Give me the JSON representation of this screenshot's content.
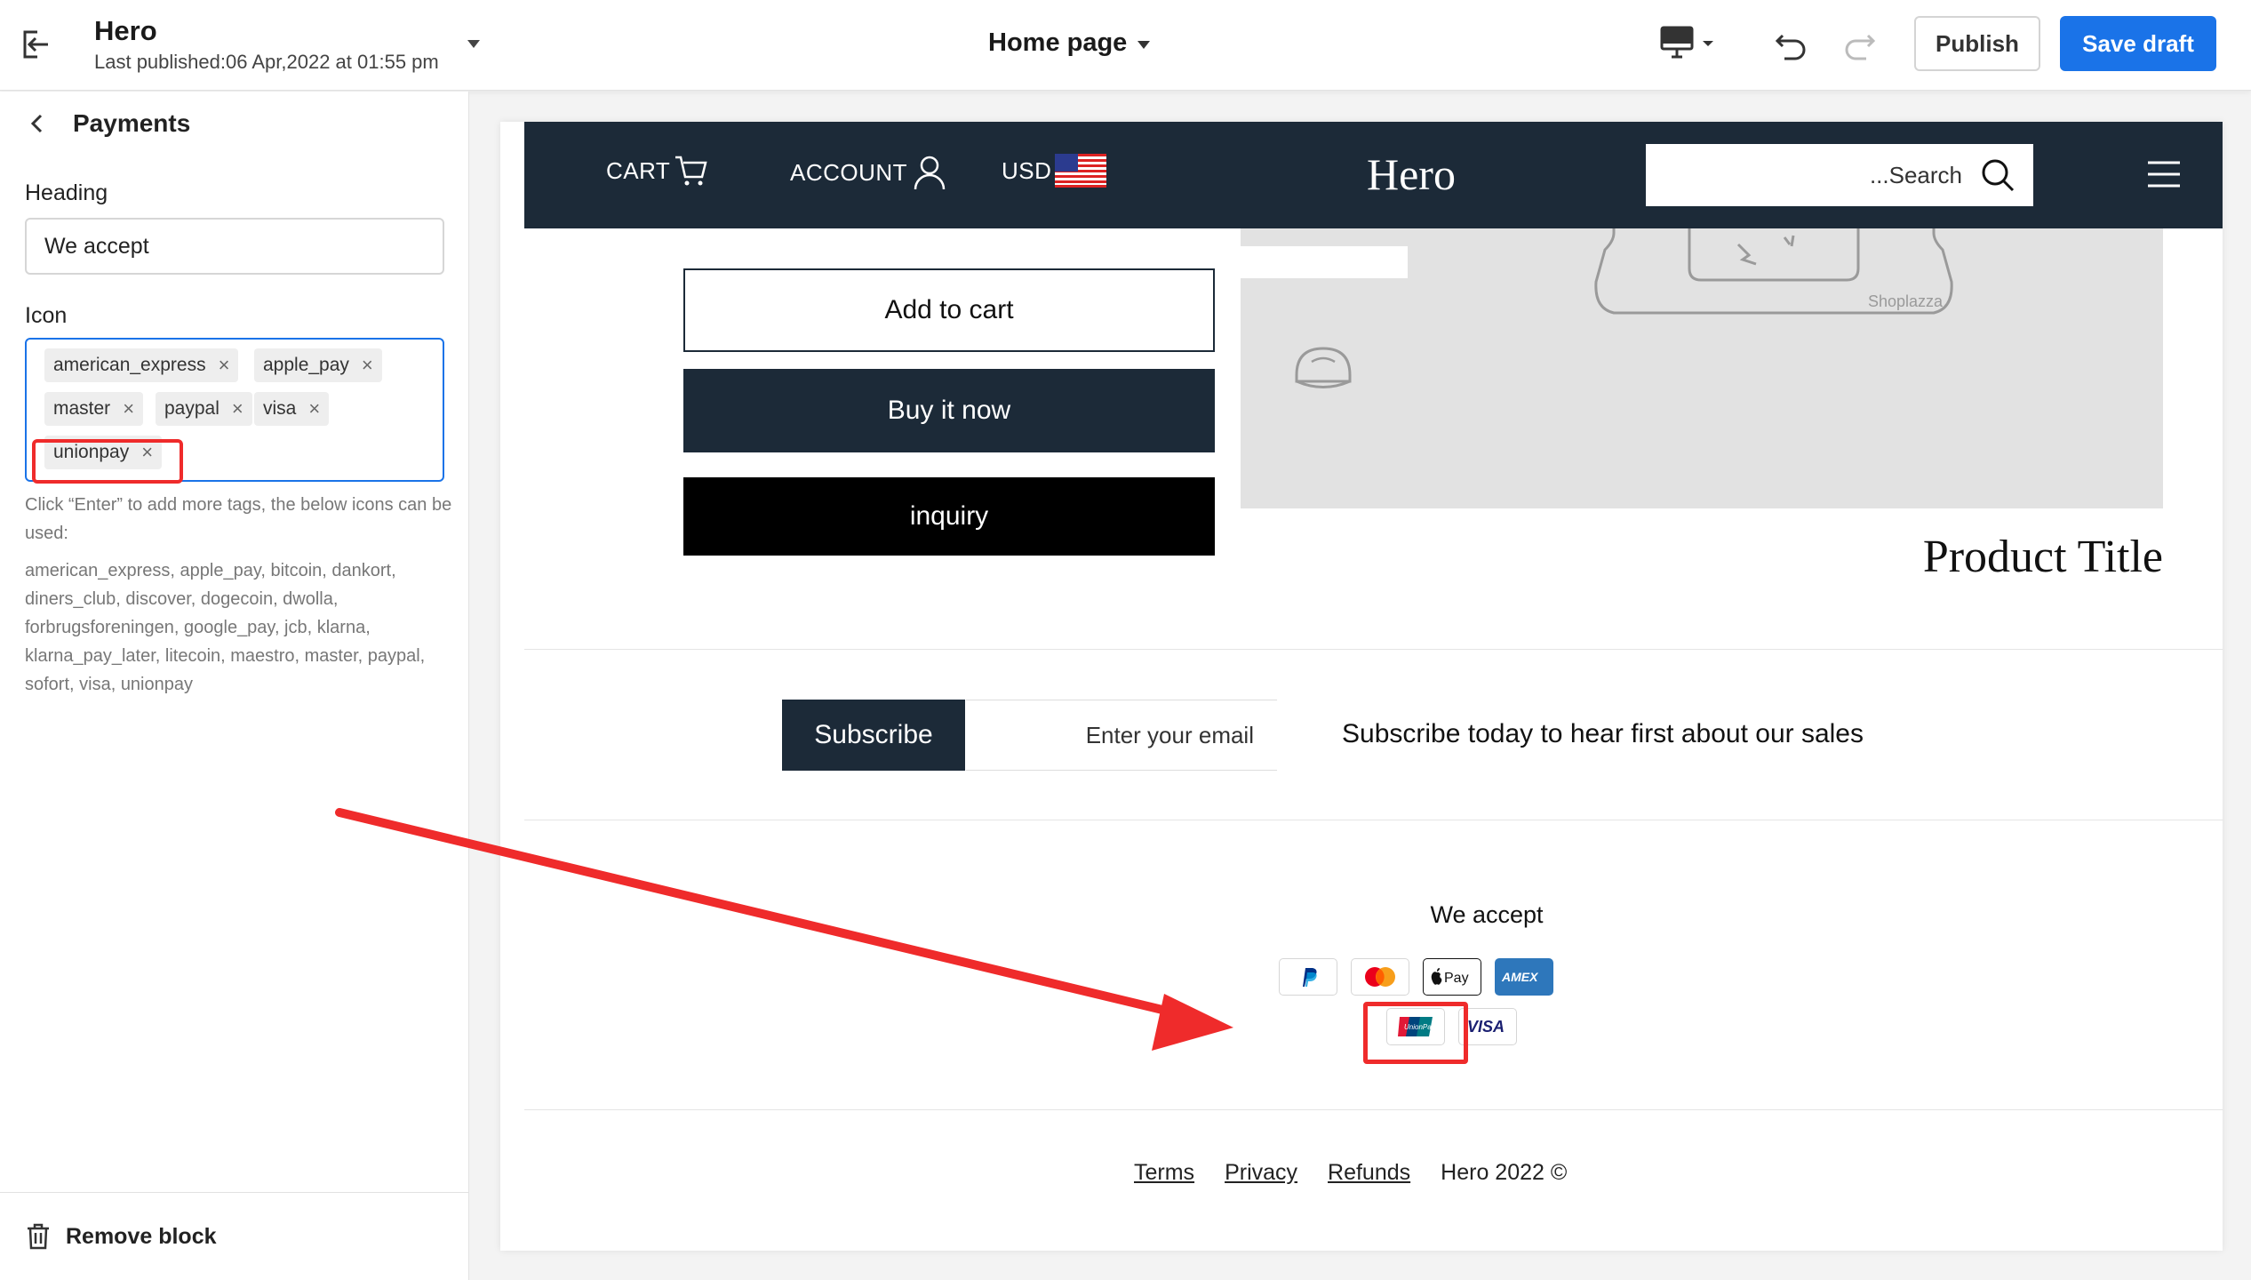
{
  "topbar": {
    "theme_name": "Hero",
    "last_published": "Last published:06 Apr,2022 at 01:55 pm",
    "page_selector": "Home page",
    "publish_label": "Publish",
    "save_draft_label": "Save draft",
    "accent_color": "#1a73e8"
  },
  "panel": {
    "title": "Payments",
    "heading_label": "Heading",
    "heading_value": "We accept",
    "icon_label": "Icon",
    "tags": [
      {
        "label": "american_express"
      },
      {
        "label": "apple_pay"
      },
      {
        "label": "master"
      },
      {
        "label": "paypal"
      },
      {
        "label": "visa"
      },
      {
        "label": "unionpay"
      }
    ],
    "helper_text": "Click “Enter” to add more tags, the below icons can be used:",
    "available_icons": "american_express, apple_pay, bitcoin, dankort, diners_club, discover, dogecoin, dwolla, forbrugsforeningen, google_pay, jcb, klarna, klarna_pay_later, litecoin, maestro, master, paypal, sofort, visa, unionpay",
    "remove_block_label": "Remove block"
  },
  "store": {
    "nav": {
      "cart": "CART",
      "account": "ACCOUNT",
      "currency": "USD",
      "logo": "Hero",
      "search_placeholder": "...Search"
    },
    "nav_color": "#1c2a38",
    "image_watermark": "Shoplazza",
    "add_to_cart": "Add to cart",
    "buy_it_now": "Buy it now",
    "inquiry": "inquiry",
    "product_title": "Product Title",
    "subscribe_button": "Subscribe",
    "email_placeholder": "Enter your email",
    "subscribe_text": "Subscribe today to hear first about our sales",
    "accept_heading": "We accept",
    "payment_icons": [
      "paypal",
      "master",
      "apple_pay",
      "american_express",
      "unionpay",
      "visa"
    ],
    "footer": {
      "terms": "Terms",
      "privacy": "Privacy",
      "refunds": "Refunds",
      "copyright": "Hero 2022 ©"
    }
  },
  "annotation": {
    "highlight_color": "#ef2b2b"
  }
}
